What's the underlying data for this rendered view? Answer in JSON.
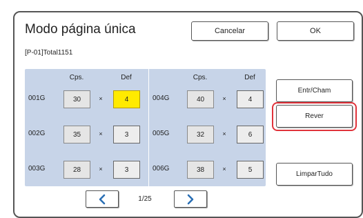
{
  "title": "Modo página única",
  "buttons": {
    "cancel": "Cancelar",
    "ok": "OK"
  },
  "info": "[P-01]Total1151",
  "columns": {
    "copies": "Cps.",
    "def": "Def"
  },
  "times_symbol": "×",
  "rows_left": [
    {
      "label": "001G",
      "copies": "30",
      "def": "4"
    },
    {
      "label": "002G",
      "copies": "35",
      "def": "3"
    },
    {
      "label": "003G",
      "copies": "28",
      "def": "3"
    }
  ],
  "rows_right": [
    {
      "label": "004G",
      "copies": "40",
      "def": "4"
    },
    {
      "label": "005G",
      "copies": "32",
      "def": "6"
    },
    {
      "label": "006G",
      "copies": "38",
      "def": "5"
    }
  ],
  "side": {
    "entr": "Entr/Cham",
    "rever": "Rever",
    "limpar": "LimparTudo"
  },
  "pagination": {
    "current": "1/25",
    "prev_icon": "chevron-left-icon",
    "next_icon": "chevron-right-icon"
  },
  "colors": {
    "accent": "#2a6fb5",
    "highlight": "#e0323a",
    "active_cell": "#ffea00",
    "panel": "#c7d4e8"
  }
}
